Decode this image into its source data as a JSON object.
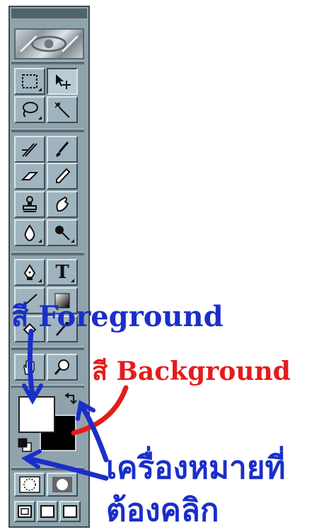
{
  "toolbox": {
    "tools": [
      {
        "id": "marquee",
        "icon": "rect-marquee-icon"
      },
      {
        "id": "move",
        "icon": "move-arrow-icon"
      },
      {
        "id": "lasso",
        "icon": "lasso-icon"
      },
      {
        "id": "magic-wand",
        "icon": "magic-wand-icon"
      },
      {
        "id": "airbrush",
        "icon": "airbrush-icon"
      },
      {
        "id": "paintbrush",
        "icon": "paintbrush-icon"
      },
      {
        "id": "eraser",
        "icon": "eraser-icon"
      },
      {
        "id": "pencil",
        "icon": "pencil-icon"
      },
      {
        "id": "rubber-stamp",
        "icon": "stamp-icon"
      },
      {
        "id": "smudge",
        "icon": "smudge-hand-icon"
      },
      {
        "id": "blur",
        "icon": "water-drop-icon"
      },
      {
        "id": "dodge",
        "icon": "dodge-icon"
      },
      {
        "id": "pen",
        "icon": "pen-nib-icon"
      },
      {
        "id": "type",
        "icon": "type-icon",
        "glyph": "T"
      },
      {
        "id": "line",
        "icon": "line-icon"
      },
      {
        "id": "gradient",
        "icon": "gradient-icon"
      },
      {
        "id": "paint-bucket",
        "icon": "paint-bucket-icon"
      },
      {
        "id": "eyedropper",
        "icon": "eyedropper-icon"
      },
      {
        "id": "hand",
        "icon": "hand-icon"
      },
      {
        "id": "zoom",
        "icon": "magnifier-icon"
      }
    ],
    "foreground_color": "#ffffff",
    "background_color": "#000000"
  },
  "annotations": {
    "foreground_label": "สี Foreground",
    "background_label": "สี Background",
    "marker_line1": "เครื่องหมายที่",
    "marker_line2": "ต้องคลิก",
    "foreground_color": "#1a2fc9",
    "background_color": "#e51b1b"
  }
}
